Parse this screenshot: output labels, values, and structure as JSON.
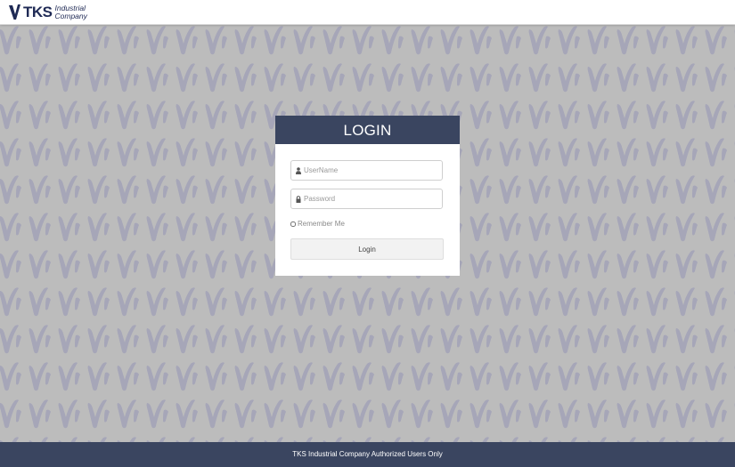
{
  "brand": {
    "logo_letters": "TKS",
    "logo_line1": "Industrial",
    "logo_line2": "Company",
    "color": "#1f2a55"
  },
  "background": {
    "color": "#bcbcbc",
    "pattern_color": "#a4a4b6",
    "pattern_icon": "tks-v-logo-pattern"
  },
  "login": {
    "title": "LOGIN",
    "header_color": "#3a4560",
    "username": {
      "placeholder": "UserName",
      "value": "",
      "icon": "user-icon"
    },
    "password": {
      "placeholder": "Password",
      "value": "",
      "icon": "lock-icon"
    },
    "remember_label": "Remember Me",
    "remember_checked": false,
    "button_label": "Login"
  },
  "footer": {
    "text": "TKS Industrial Company Authorized Users Only",
    "color": "#3a4560"
  }
}
